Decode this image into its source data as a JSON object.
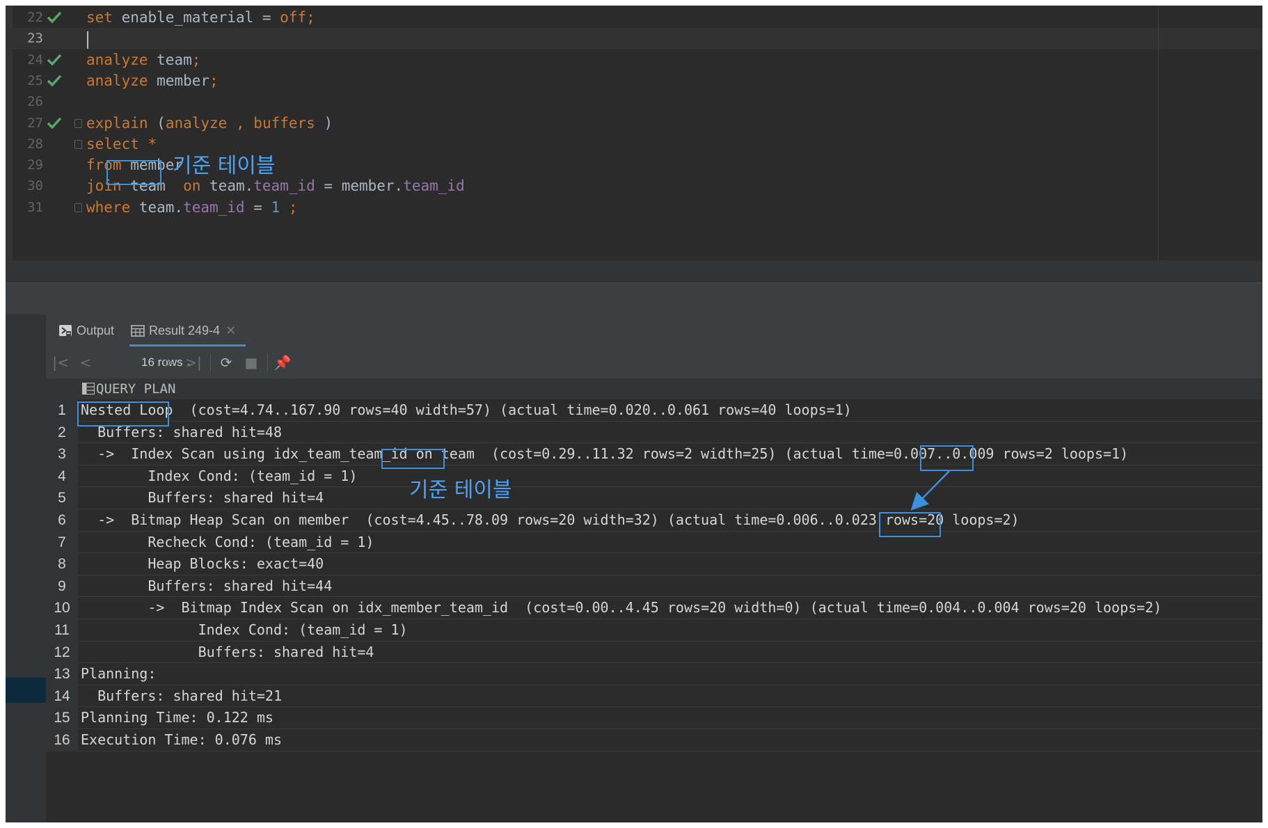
{
  "editor": {
    "lines": [
      {
        "num": "22",
        "status": "ok",
        "fold": false,
        "current": false,
        "tokens": [
          [
            "kw",
            "set"
          ],
          [
            "txt",
            " enable_material = "
          ],
          [
            "kw",
            "off;"
          ]
        ]
      },
      {
        "num": "23",
        "status": "",
        "fold": false,
        "current": true,
        "tokens": []
      },
      {
        "num": "24",
        "status": "ok",
        "fold": false,
        "current": false,
        "tokens": [
          [
            "kw",
            "analyze"
          ],
          [
            "txt",
            " team"
          ],
          [
            "kw",
            ";"
          ]
        ]
      },
      {
        "num": "25",
        "status": "ok",
        "fold": false,
        "current": false,
        "tokens": [
          [
            "kw",
            "analyze"
          ],
          [
            "txt",
            " member"
          ],
          [
            "kw",
            ";"
          ]
        ]
      },
      {
        "num": "26",
        "status": "",
        "fold": false,
        "current": false,
        "tokens": []
      },
      {
        "num": "27",
        "status": "ok",
        "fold": true,
        "current": false,
        "tokens": [
          [
            "kw",
            "explain"
          ],
          [
            "txt",
            " ("
          ],
          [
            "kw",
            "analyze"
          ],
          [
            "txt",
            " "
          ],
          [
            "kw",
            ","
          ],
          [
            "txt",
            " "
          ],
          [
            "kw",
            "buffers"
          ],
          [
            "txt",
            " )"
          ]
        ]
      },
      {
        "num": "28",
        "status": "",
        "fold": true,
        "current": false,
        "tokens": [
          [
            "kw",
            "select"
          ],
          [
            "txt",
            " "
          ],
          [
            "kw",
            "*"
          ]
        ]
      },
      {
        "num": "29",
        "status": "",
        "fold": false,
        "current": false,
        "tokens": [
          [
            "kw",
            "from"
          ],
          [
            "txt",
            " member"
          ]
        ]
      },
      {
        "num": "30",
        "status": "",
        "fold": false,
        "current": false,
        "tokens": [
          [
            "kw",
            "join"
          ],
          [
            "txt",
            " team  "
          ],
          [
            "kw",
            "on"
          ],
          [
            "txt",
            " team."
          ],
          [
            "fld",
            "team_id"
          ],
          [
            "txt",
            " = member."
          ],
          [
            "fld",
            "team_id"
          ]
        ]
      },
      {
        "num": "31",
        "status": "",
        "fold": true,
        "current": false,
        "tokens": [
          [
            "kw",
            "where"
          ],
          [
            "txt",
            " team."
          ],
          [
            "fld",
            "team_id"
          ],
          [
            "txt",
            " = "
          ],
          [
            "num",
            "1"
          ],
          [
            "txt",
            " "
          ],
          [
            "kw",
            ";"
          ]
        ]
      }
    ]
  },
  "annotations": {
    "base_table_label_1": "기준 테이블",
    "base_table_label_2": "기준 테이블",
    "color": "#3d8fe0"
  },
  "result_panel": {
    "tabs": [
      {
        "label": "Output",
        "icon": "console-icon",
        "active": false
      },
      {
        "label": "Result 249-4",
        "icon": "table-icon",
        "active": true,
        "closable": true
      }
    ],
    "toolbar": {
      "rows_label": "16 rows",
      "icons": [
        "first-page-icon",
        "prev-page-icon",
        "next-page-icon",
        "last-page-icon",
        "refresh-icon",
        "stop-icon",
        "pin-icon"
      ]
    },
    "column_header": "QUERY PLAN",
    "rows": [
      {
        "n": "1",
        "text": "Nested Loop  (cost=4.74..167.90 rows=40 width=57) (actual time=0.020..0.061 rows=40 loops=1)"
      },
      {
        "n": "2",
        "text": "  Buffers: shared hit=48"
      },
      {
        "n": "3",
        "text": "  ->  Index Scan using idx_team_team_id on team  (cost=0.29..11.32 rows=2 width=25) (actual time=0.007..0.009 rows=2 loops=1)"
      },
      {
        "n": "4",
        "text": "        Index Cond: (team_id = 1)"
      },
      {
        "n": "5",
        "text": "        Buffers: shared hit=4"
      },
      {
        "n": "6",
        "text": "  ->  Bitmap Heap Scan on member  (cost=4.45..78.09 rows=20 width=32) (actual time=0.006..0.023 rows=20 loops=2)"
      },
      {
        "n": "7",
        "text": "        Recheck Cond: (team_id = 1)"
      },
      {
        "n": "8",
        "text": "        Heap Blocks: exact=40"
      },
      {
        "n": "9",
        "text": "        Buffers: shared hit=44"
      },
      {
        "n": "10",
        "text": "        ->  Bitmap Index Scan on idx_member_team_id  (cost=0.00..4.45 rows=20 width=0) (actual time=0.004..0.004 rows=20 loops=2)"
      },
      {
        "n": "11",
        "text": "              Index Cond: (team_id = 1)"
      },
      {
        "n": "12",
        "text": "              Buffers: shared hit=4"
      },
      {
        "n": "13",
        "text": "Planning:"
      },
      {
        "n": "14",
        "text": "  Buffers: shared hit=21"
      },
      {
        "n": "15",
        "text": "Planning Time: 0.122 ms"
      },
      {
        "n": "16",
        "text": "Execution Time: 0.076 ms"
      }
    ]
  }
}
